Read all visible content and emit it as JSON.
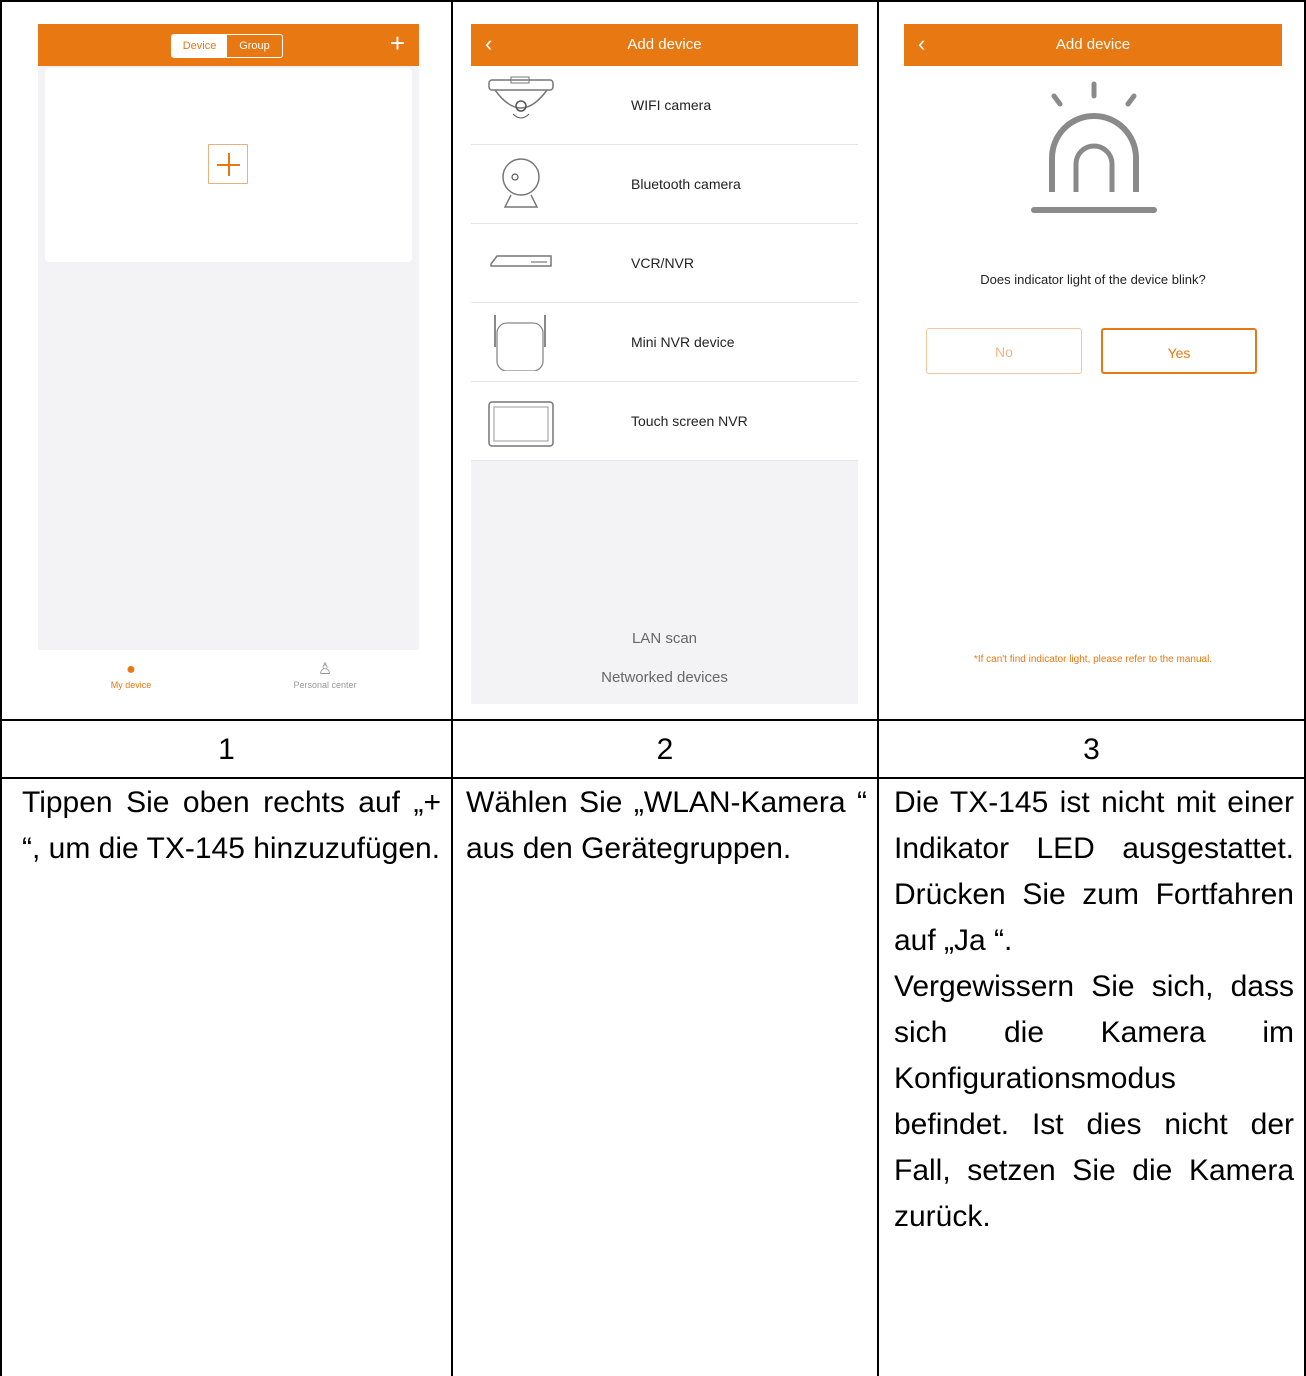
{
  "screen1": {
    "segment": {
      "device": "Device",
      "group": "Group"
    },
    "plus_label": "+",
    "tabs": {
      "my_device": "My device",
      "personal_center": "Personal center"
    }
  },
  "screen2": {
    "title": "Add device",
    "items": [
      {
        "label": "WIFI camera"
      },
      {
        "label": "Bluetooth camera"
      },
      {
        "label": "VCR/NVR"
      },
      {
        "label": "Mini NVR device"
      },
      {
        "label": "Touch screen NVR"
      }
    ],
    "lan_scan": "LAN scan",
    "networked": "Networked devices"
  },
  "screen3": {
    "title": "Add device",
    "question": "Does indicator light of the device blink?",
    "no": "No",
    "yes": "Yes",
    "footnote": "*If can't find indicator light, please refer to the manual."
  },
  "steps": [
    {
      "number": "1",
      "text": "Tippen Sie oben rechts auf „+ “, um die TX-145 hinzuzufügen."
    },
    {
      "number": "2",
      "text": "Wählen Sie „WLAN-Kamera “ aus den Gerätegruppen."
    },
    {
      "number": "3",
      "text": "Die TX-145 ist nicht mit einer Indikator LED ausgestattet. Drücken Sie zum Fortfahren auf „Ja “.",
      "text2": "Vergewissern Sie sich, dass sich die Kamera im Konfigurationsmodus befindet. Ist dies nicht der Fall, setzen Sie die Kamera zurück."
    }
  ],
  "colors": {
    "accent": "#e87811"
  }
}
